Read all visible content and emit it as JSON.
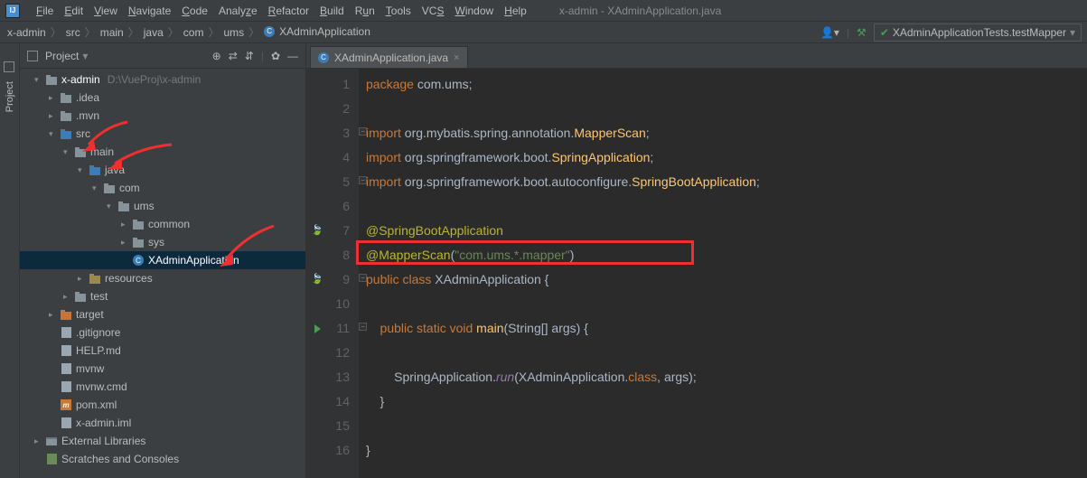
{
  "menu": {
    "items": [
      "File",
      "Edit",
      "View",
      "Navigate",
      "Code",
      "Analyze",
      "Refactor",
      "Build",
      "Run",
      "Tools",
      "VCS",
      "Window",
      "Help"
    ],
    "title": "x-admin - XAdminApplication.java"
  },
  "breadcrumb": [
    "x-admin",
    "src",
    "main",
    "java",
    "com",
    "ums",
    "XAdminApplication"
  ],
  "runConfig": "XAdminApplicationTests.testMapper",
  "projectPanel": {
    "title": "Project"
  },
  "tree": {
    "root": {
      "name": "x-admin",
      "path": "D:\\VueProj\\x-admin"
    },
    "items": [
      {
        "name": ".idea",
        "indent": 1,
        "arrow": ">",
        "icon": "folder"
      },
      {
        "name": ".mvn",
        "indent": 1,
        "arrow": ">",
        "icon": "folder"
      },
      {
        "name": "src",
        "indent": 1,
        "arrow": "v",
        "icon": "folder-src"
      },
      {
        "name": "main",
        "indent": 2,
        "arrow": "v",
        "icon": "folder"
      },
      {
        "name": "java",
        "indent": 3,
        "arrow": "v",
        "icon": "folder-src"
      },
      {
        "name": "com",
        "indent": 4,
        "arrow": "v",
        "icon": "folder-pkg"
      },
      {
        "name": "ums",
        "indent": 5,
        "arrow": "v",
        "icon": "folder-pkg"
      },
      {
        "name": "common",
        "indent": 6,
        "arrow": ">",
        "icon": "folder-pkg"
      },
      {
        "name": "sys",
        "indent": 6,
        "arrow": ">",
        "icon": "folder-pkg"
      },
      {
        "name": "XAdminApplication",
        "indent": 6,
        "arrow": "",
        "icon": "class-run",
        "selected": true
      },
      {
        "name": "resources",
        "indent": 3,
        "arrow": ">",
        "icon": "folder-res"
      },
      {
        "name": "test",
        "indent": 2,
        "arrow": ">",
        "icon": "folder"
      },
      {
        "name": "target",
        "indent": 1,
        "arrow": ">",
        "icon": "folder-tgt"
      },
      {
        "name": ".gitignore",
        "indent": 1,
        "arrow": "",
        "icon": "file"
      },
      {
        "name": "HELP.md",
        "indent": 1,
        "arrow": "",
        "icon": "file"
      },
      {
        "name": "mvnw",
        "indent": 1,
        "arrow": "",
        "icon": "file"
      },
      {
        "name": "mvnw.cmd",
        "indent": 1,
        "arrow": "",
        "icon": "file"
      },
      {
        "name": "pom.xml",
        "indent": 1,
        "arrow": "",
        "icon": "m"
      },
      {
        "name": "x-admin.iml",
        "indent": 1,
        "arrow": "",
        "icon": "file"
      }
    ],
    "externals": "External Libraries",
    "scratches": "Scratches and Consoles"
  },
  "tab": {
    "label": "XAdminApplication.java"
  },
  "code": {
    "line1": {
      "kw": "package",
      "rest": " com.ums;"
    },
    "line3": {
      "kw": "import",
      "rest": " org.mybatis.spring.annotation.",
      "cls": "MapperScan",
      "end": ";"
    },
    "line4": {
      "kw": "import",
      "rest": " org.springframework.boot.",
      "cls": "SpringApplication",
      "end": ";"
    },
    "line5": {
      "kw": "import",
      "rest": " org.springframework.boot.autoconfigure.",
      "cls": "SpringBootApplication",
      "end": ";"
    },
    "line7": {
      "ann": "@SpringBootApplication"
    },
    "line8": {
      "ann": "@MapperScan",
      "paren": "(",
      "str": "\"com.ums.*.mapper\"",
      "paren2": ")"
    },
    "line9": {
      "kw": "public class",
      "cls": " XAdminApplication {"
    },
    "line11": {
      "kw": "    public static void",
      "fn": " main",
      "rest": "(String[] args) {"
    },
    "line13": {
      "pre": "        SpringApplication.",
      "it": "run",
      "rest": "(XAdminApplication.",
      "kw2": "class",
      "rest2": ", args);"
    },
    "line14": {
      "txt": "    }"
    },
    "line16": {
      "txt": "}"
    }
  },
  "lineNumbers": [
    "1",
    "2",
    "3",
    "4",
    "5",
    "6",
    "7",
    "8",
    "9",
    "10",
    "11",
    "12",
    "13",
    "14",
    "15",
    "16"
  ]
}
